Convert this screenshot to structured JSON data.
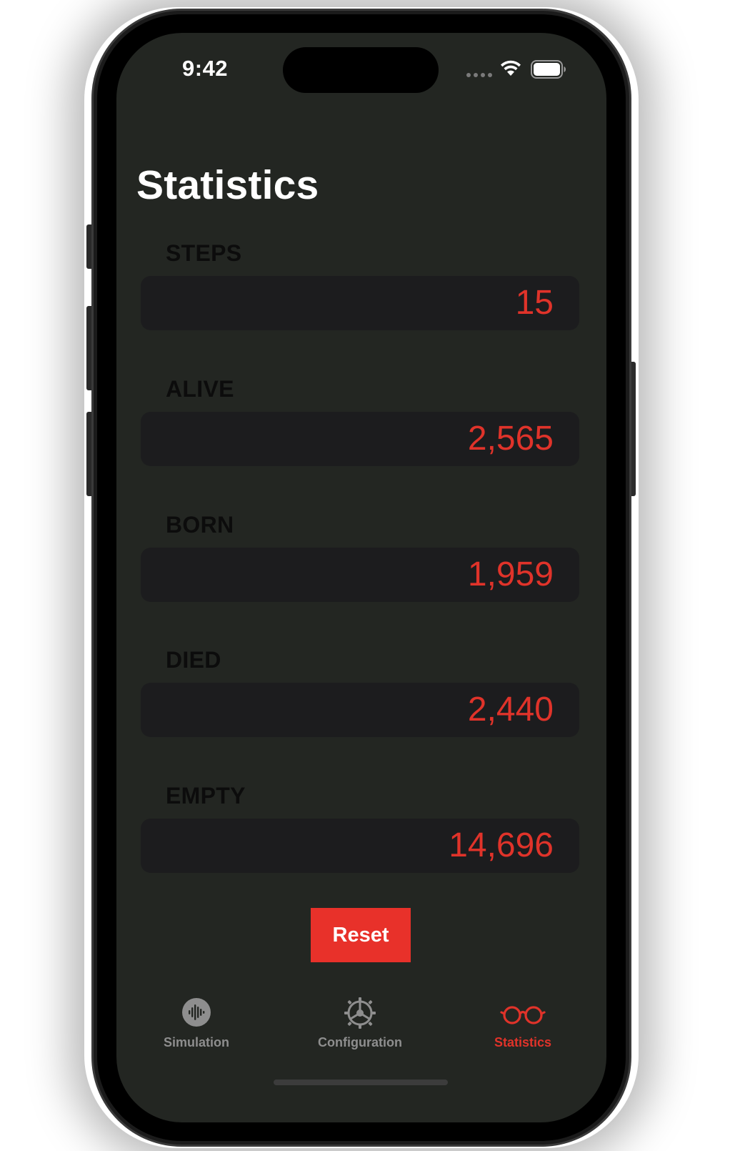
{
  "status_bar": {
    "time": "9:42"
  },
  "title": "Statistics",
  "stats": [
    {
      "label": "STEPS",
      "value": "15"
    },
    {
      "label": "ALIVE",
      "value": "2,565"
    },
    {
      "label": "BORN",
      "value": "1,959"
    },
    {
      "label": "DIED",
      "value": "2,440"
    },
    {
      "label": "EMPTY",
      "value": "14,696"
    }
  ],
  "reset_label": "Reset",
  "tabs": [
    {
      "label": "Simulation",
      "icon": "waveform-icon"
    },
    {
      "label": "Configuration",
      "icon": "gear-icon"
    },
    {
      "label": "Statistics",
      "icon": "eyeglasses-icon"
    }
  ],
  "colors": {
    "accent": "#e0332a",
    "background": "#232622",
    "field": "#1c1c1e",
    "inactive_tab": "#8e8e8e"
  }
}
